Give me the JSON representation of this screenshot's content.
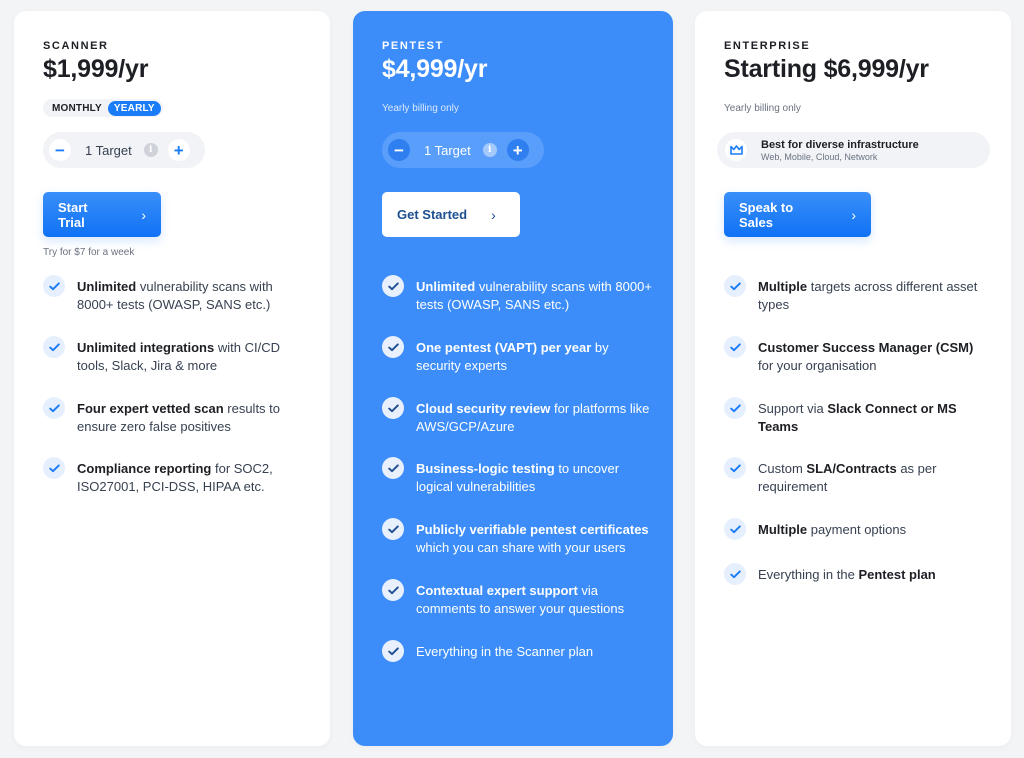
{
  "plans": {
    "scanner": {
      "name": "SCANNER",
      "price": "$1,999/yr",
      "toggle": {
        "monthly": "MONTHLY",
        "yearly": "YEARLY",
        "selected": "yearly"
      },
      "stepper": {
        "minus": "−",
        "value": "1 Target",
        "plus": "+",
        "info": "i"
      },
      "cta": "Start Trial",
      "note": "Try for $7 for a week",
      "features": [
        {
          "bold": "Unlimited",
          "rest": " vulnerability scans with 8000+ tests (OWASP, SANS etc.)"
        },
        {
          "bold": "Unlimited integrations",
          "rest": " with CI/CD tools, Slack, Jira & more"
        },
        {
          "bold": "Four expert vetted scan",
          "rest": " results to ensure zero false positives"
        },
        {
          "bold": "Compliance reporting",
          "rest": " for SOC2, ISO27001, PCI-DSS, HIPAA etc."
        }
      ]
    },
    "pentest": {
      "name": "PENTEST",
      "price": "$4,999/yr",
      "billing": "Yearly billing only",
      "stepper": {
        "minus": "−",
        "value": "1 Target",
        "plus": "+",
        "info": "i"
      },
      "cta": "Get Started",
      "features": [
        {
          "bold": "Unlimited",
          "rest": " vulnerability scans with 8000+ tests (OWASP, SANS etc.)"
        },
        {
          "bold": "One pentest (VAPT) per year",
          "rest": " by security experts"
        },
        {
          "bold": "Cloud security review",
          "rest": " for platforms like AWS/GCP/Azure"
        },
        {
          "bold": "Business-logic testing",
          "rest": " to uncover logical vulnerabilities"
        },
        {
          "bold": "Publicly verifiable pentest certificates",
          "rest": " which you can share with your users"
        },
        {
          "bold": "Contextual expert support",
          "rest": " via comments to answer your questions"
        },
        {
          "bold": "",
          "rest": "Everything in the Scanner plan"
        }
      ]
    },
    "enterprise": {
      "name": "ENTERPRISE",
      "price": "Starting $6,999/yr",
      "billing": "Yearly billing only",
      "badge": {
        "title": "Best for diverse infrastructure",
        "subtitle": "Web, Mobile, Cloud, Network"
      },
      "cta": "Speak to Sales",
      "features": [
        {
          "pre": "",
          "bold": "Multiple",
          "rest": " targets across different asset types"
        },
        {
          "pre": "",
          "bold": "Customer Success Manager (CSM)",
          "rest": " for your organisation"
        },
        {
          "pre": "Support via ",
          "bold": "Slack Connect or MS Teams",
          "rest": ""
        },
        {
          "pre": "Custom ",
          "bold": "SLA/Contracts",
          "rest": " as per requirement"
        },
        {
          "pre": "",
          "bold": "Multiple",
          "rest": " payment options"
        },
        {
          "pre": "Everything in the ",
          "bold": "Pentest plan",
          "rest": ""
        }
      ]
    }
  },
  "colors": {
    "accent": "#1a7cf7",
    "pentest_card": "#3c8df9",
    "background": "#f3f4f6"
  }
}
